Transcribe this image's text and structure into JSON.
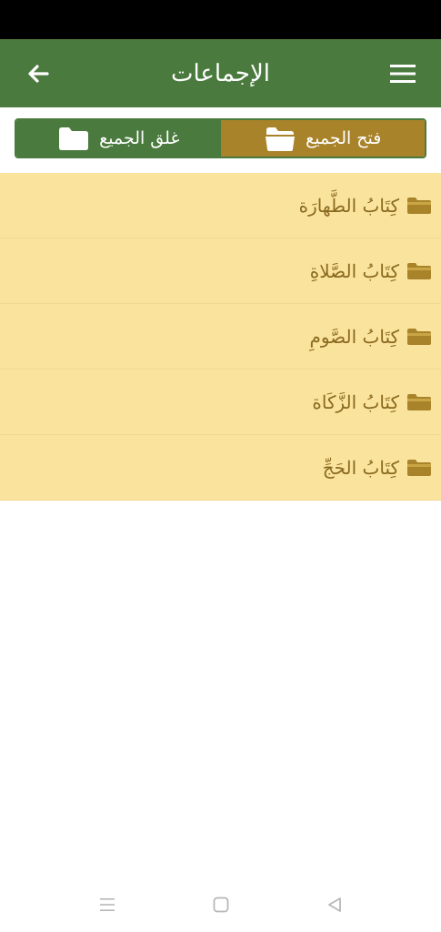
{
  "app_bar": {
    "title": "الإجماعات",
    "back_icon": "arrow-left-icon",
    "menu_icon": "hamburger-menu-icon",
    "background": "#4a7a3d"
  },
  "toggle": {
    "open_all_label": "فتح الجميع",
    "close_all_label": "غلق الجميع",
    "open_all_color": "#a8832a",
    "close_all_color": "#4a7a3d"
  },
  "chapters": [
    {
      "label": "كِتَابُ الطَّهارَة",
      "icon": "folder-icon"
    },
    {
      "label": "كِتَابُ الصَّلاةِ",
      "icon": "folder-icon"
    },
    {
      "label": "كِتَابُ الصَّومِ",
      "icon": "folder-icon"
    },
    {
      "label": "كِتَابُ الزَّكَاة",
      "icon": "folder-icon"
    },
    {
      "label": "كِتَابُ الحَجِّ",
      "icon": "folder-icon"
    }
  ],
  "list_background": "#fae39d",
  "system_nav": {
    "recents_icon": "recents-icon",
    "home_icon": "home-icon",
    "back_icon": "system-back-icon"
  }
}
